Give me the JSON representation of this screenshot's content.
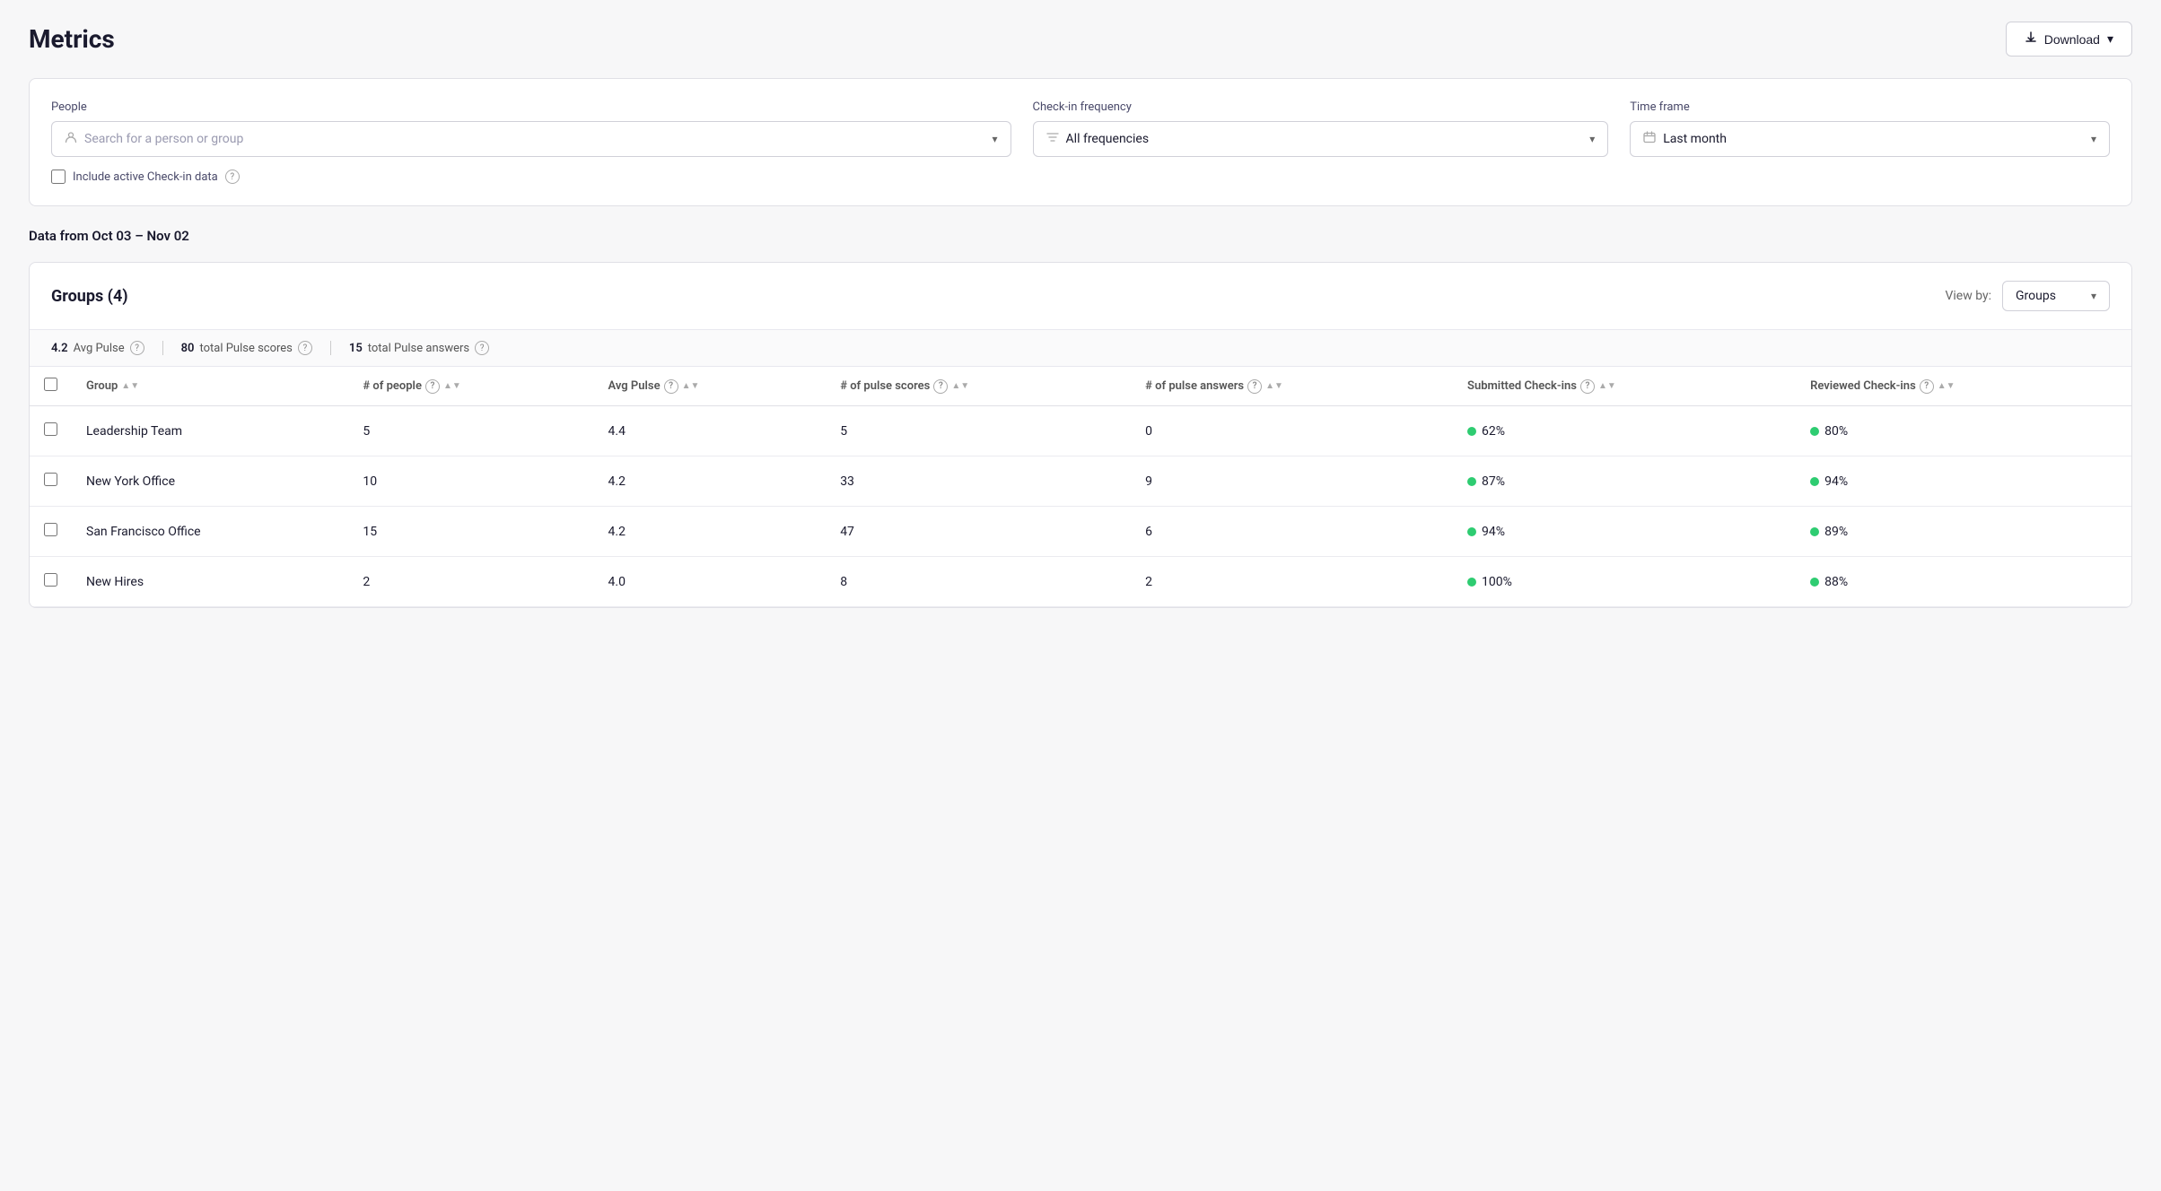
{
  "page": {
    "title": "Metrics",
    "download_label": "Download"
  },
  "filters": {
    "people_label": "People",
    "people_placeholder": "Search for a person or group",
    "frequency_label": "Check-in frequency",
    "frequency_value": "All frequencies",
    "timeframe_label": "Time frame",
    "timeframe_value": "Last month",
    "include_active_label": "Include active Check-in data"
  },
  "data_range": "Data from Oct 03 – Nov 02",
  "table": {
    "title": "Groups (4)",
    "view_by_label": "View by:",
    "view_by_value": "Groups",
    "summary": [
      {
        "value": "4.2",
        "label": "Avg Pulse"
      },
      {
        "value": "80",
        "label": "total Pulse scores"
      },
      {
        "value": "15",
        "label": "total Pulse answers"
      }
    ],
    "columns": [
      {
        "label": "Group",
        "sortable": true
      },
      {
        "label": "# of people",
        "sortable": true,
        "has_help": true
      },
      {
        "label": "Avg Pulse",
        "sortable": true,
        "has_help": true
      },
      {
        "label": "# of pulse scores",
        "sortable": true,
        "has_help": true
      },
      {
        "label": "# of pulse answers",
        "sortable": true,
        "has_help": true
      },
      {
        "label": "Submitted Check-ins",
        "sortable": true,
        "has_help": true
      },
      {
        "label": "Reviewed Check-ins",
        "sortable": true,
        "has_help": true
      }
    ],
    "rows": [
      {
        "group": "Leadership Team",
        "people": "5",
        "avg_pulse": "4.4",
        "pulse_scores": "5",
        "pulse_answers": "0",
        "submitted": "62%",
        "submitted_color": "green",
        "reviewed": "80%",
        "reviewed_color": "green"
      },
      {
        "group": "New York Office",
        "people": "10",
        "avg_pulse": "4.2",
        "pulse_scores": "33",
        "pulse_answers": "9",
        "submitted": "87%",
        "submitted_color": "green",
        "reviewed": "94%",
        "reviewed_color": "green"
      },
      {
        "group": "San Francisco Office",
        "people": "15",
        "avg_pulse": "4.2",
        "pulse_scores": "47",
        "pulse_answers": "6",
        "submitted": "94%",
        "submitted_color": "green",
        "reviewed": "89%",
        "reviewed_color": "green"
      },
      {
        "group": "New Hires",
        "people": "2",
        "avg_pulse": "4.0",
        "pulse_scores": "8",
        "pulse_answers": "2",
        "submitted": "100%",
        "submitted_color": "green",
        "reviewed": "88%",
        "reviewed_color": "green"
      }
    ]
  }
}
